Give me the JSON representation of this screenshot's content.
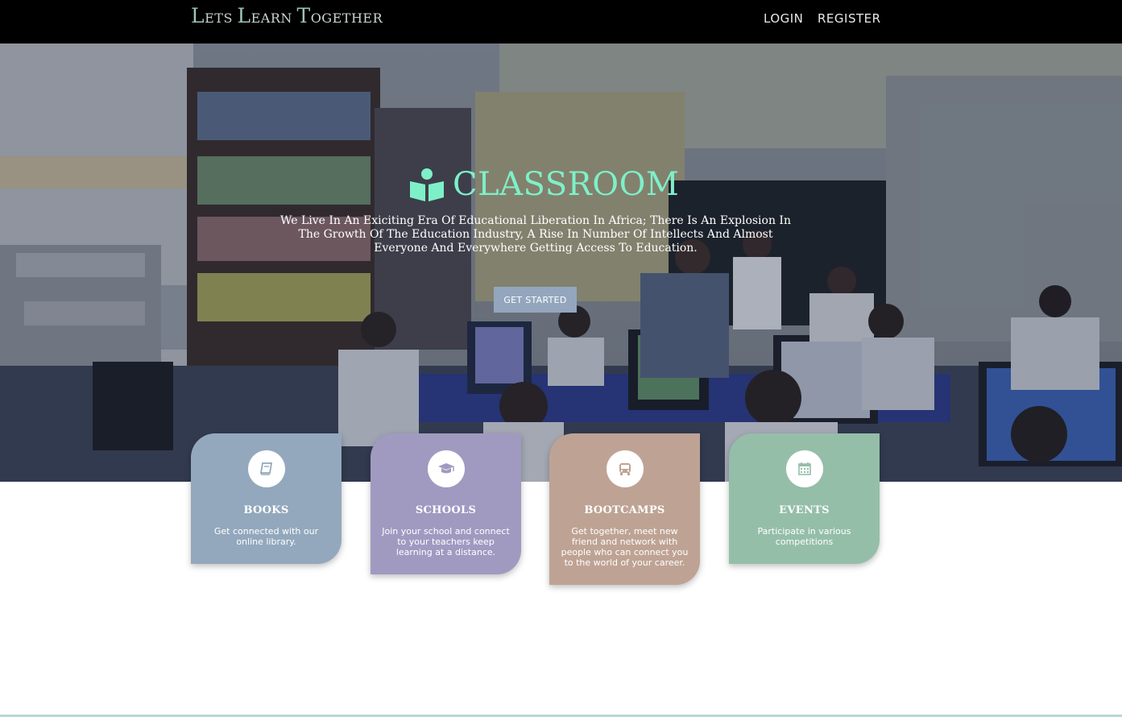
{
  "header": {
    "brand": [
      {
        "cap": "L",
        "rest": "ETS "
      },
      {
        "cap": "L",
        "rest": "EARN "
      },
      {
        "cap": "T",
        "rest": "OGETHER"
      }
    ],
    "nav": {
      "login": "LOGIN",
      "register": "REGISTER"
    }
  },
  "hero": {
    "title": "CLASSROOM",
    "title_icon": "book-reader-icon",
    "description": "We Live In An Exiciting Era Of Educational Liberation In Africa; There Is An Explosion In The Growth Of The Education Industry, A Rise In Number Of Intellects And Almost Everyone And Everywhere Getting Access To Education.",
    "button": "GET STARTED"
  },
  "cards": [
    {
      "title": "BOOKS",
      "desc": "Get connected with our online library.",
      "icon": "book-icon",
      "color": "#93a8bd"
    },
    {
      "title": "SCHOOLS",
      "desc": "Join your school and connect to your teachers keep learning at a distance.",
      "icon": "graduation-cap-icon",
      "color": "#a09ac1"
    },
    {
      "title": "BOOTCAMPS",
      "desc": "Get together, meet new friend and network with people who can connect you to the world of your career.",
      "icon": "bus-icon",
      "color": "#bea394"
    },
    {
      "title": "EVENTS",
      "desc": "Participate in various competitions",
      "icon": "calendar-icon",
      "color": "#95bea9"
    }
  ],
  "colors": {
    "accent": "#7ef0c8",
    "topbar": "#000000",
    "button": "#93a6bd"
  }
}
